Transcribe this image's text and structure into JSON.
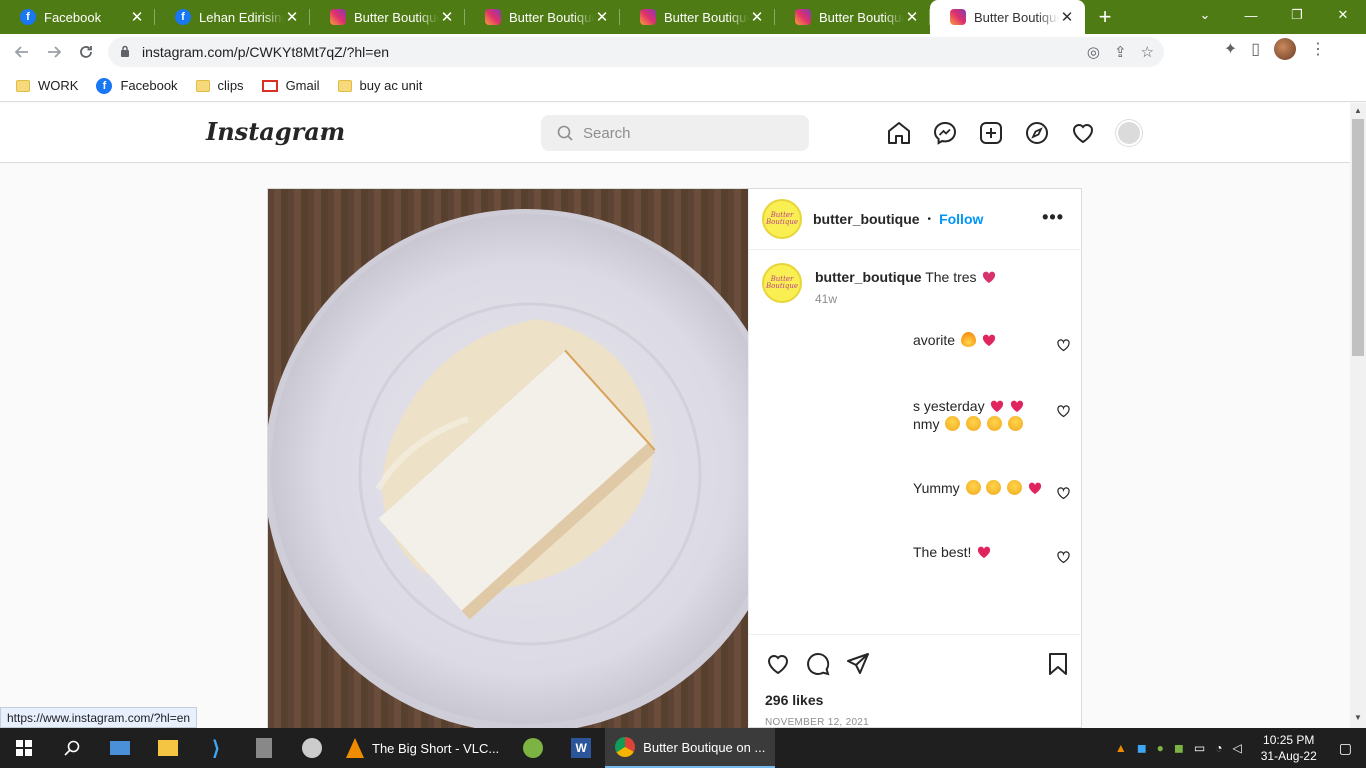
{
  "browser": {
    "tabs": [
      {
        "title": "Facebook",
        "icon": "facebook-icon",
        "active": false
      },
      {
        "title": "Lehan Edirisinghe",
        "icon": "facebook-icon",
        "active": false
      },
      {
        "title": "Butter Boutique (@",
        "icon": "instagram-icon",
        "active": false
      },
      {
        "title": "Butter Boutique (@",
        "icon": "instagram-icon",
        "active": false
      },
      {
        "title": "Butter Boutique (@",
        "icon": "instagram-icon",
        "active": false
      },
      {
        "title": "Butter Boutique (@",
        "icon": "instagram-icon",
        "active": false
      },
      {
        "title": "Butter Boutique (@",
        "icon": "instagram-icon",
        "active": true
      }
    ],
    "url": "instagram.com/p/CWKYt8Mt7qZ/?hl=en",
    "bookmarks": [
      {
        "label": "WORK",
        "icon": "folder-icon"
      },
      {
        "label": "Facebook",
        "icon": "facebook-icon"
      },
      {
        "label": "clips",
        "icon": "folder-icon"
      },
      {
        "label": "Gmail",
        "icon": "gmail-icon"
      },
      {
        "label": "buy ac unit",
        "icon": "folder-icon"
      }
    ],
    "status_url": "https://www.instagram.com/?hl=en"
  },
  "instagram": {
    "logo": "Instagram",
    "search_placeholder": "Search",
    "post": {
      "username": "butter_boutique",
      "follow_label": "Follow",
      "avatar_text": "Butter Boutique",
      "caption_user": "butter_boutique",
      "caption_text": "The tres",
      "caption_time": "41w",
      "comments": [
        {
          "text": "avorite"
        },
        {
          "line1": "s yesterday",
          "line2": "nmy"
        },
        {
          "text": "Yummy"
        },
        {
          "text": "The best!"
        }
      ],
      "likes": "296 likes",
      "date": "NOVEMBER 12, 2021"
    }
  },
  "taskbar": {
    "apps": [
      {
        "label": "The Big Short - VLC...",
        "icon": "vlc-icon"
      },
      {
        "label": "Butter Boutique on ...",
        "icon": "chrome-icon"
      }
    ],
    "time": "10:25 PM",
    "date": "31-Aug-22"
  },
  "colors": {
    "tabstrip": "#4f7b14",
    "follow": "#0095f6",
    "taskbar": "#1f1f1f"
  }
}
